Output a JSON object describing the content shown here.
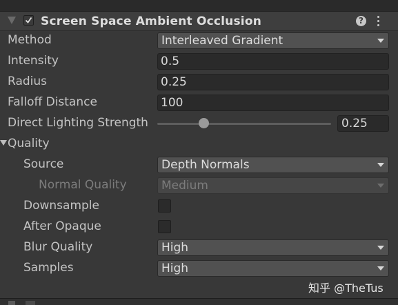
{
  "header": {
    "title": "Screen Space Ambient Occlusion",
    "enabled": true,
    "help_glyph": "?"
  },
  "rows": {
    "method": {
      "label": "Method",
      "value": "Interleaved Gradient"
    },
    "intensity": {
      "label": "Intensity",
      "value": "0.5"
    },
    "radius": {
      "label": "Radius",
      "value": "0.25"
    },
    "falloff": {
      "label": "Falloff Distance",
      "value": "100"
    },
    "direct_lighting": {
      "label": "Direct Lighting Strength",
      "value": "0.25",
      "slider_fraction": 0.25
    },
    "quality": {
      "label": "Quality",
      "expanded": true
    },
    "source": {
      "label": "Source",
      "value": "Depth Normals"
    },
    "normal_quality": {
      "label": "Normal Quality",
      "value": "Medium",
      "disabled": true
    },
    "downsample": {
      "label": "Downsample",
      "checked": false
    },
    "after_opaque": {
      "label": "After Opaque",
      "checked": false
    },
    "blur_quality": {
      "label": "Blur Quality",
      "value": "High"
    },
    "samples": {
      "label": "Samples",
      "value": "High"
    }
  },
  "watermark": "知乎 @TheTus",
  "colors": {
    "background": "#383838",
    "header": "#3e3e3e",
    "field": "#2a2a2a",
    "dropdown": "#515151",
    "text": "#c4c4c4"
  },
  "icons": {
    "foldout": "triangle-down-icon",
    "enable": "checkmark-icon",
    "help": "help-icon",
    "menu": "kebab-menu-icon"
  }
}
